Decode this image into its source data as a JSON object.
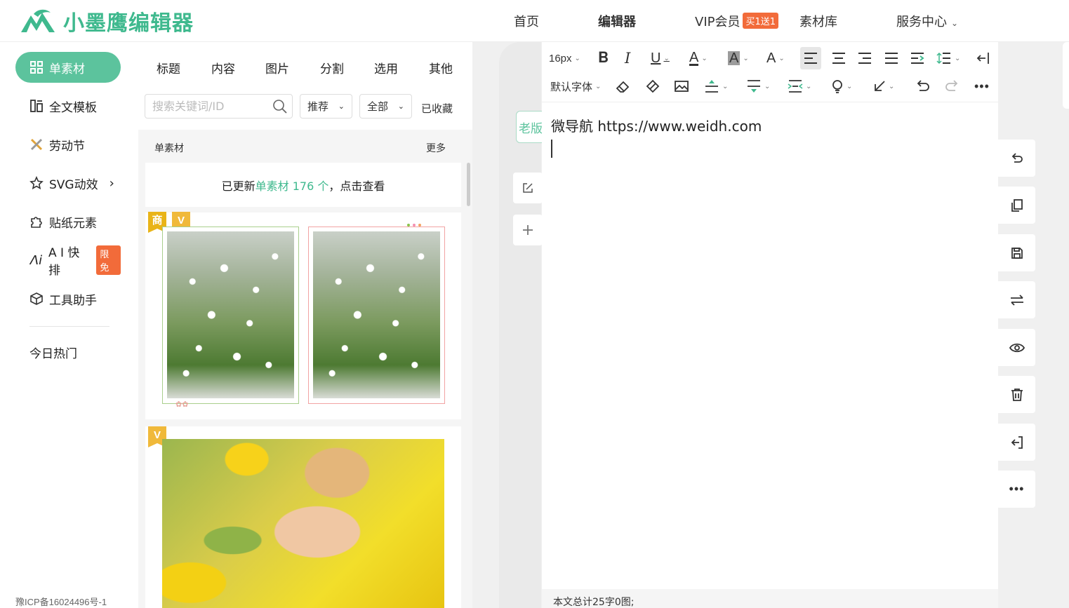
{
  "header": {
    "logo_text": "小墨鹰编辑器",
    "nav": {
      "home": "首页",
      "editor": "编辑器",
      "vip": "VIP会员",
      "vip_badge": "买1送1",
      "library": "素材库",
      "service": "服务中心"
    }
  },
  "sidebar": {
    "items": [
      {
        "label": "单素材"
      },
      {
        "label": "全文模板"
      },
      {
        "label": "劳动节"
      },
      {
        "label": "SVG动效"
      },
      {
        "label": "贴纸元素"
      },
      {
        "label": "A I 快排",
        "badge": "限免"
      },
      {
        "label": "工具助手"
      },
      {
        "label": "今日热门"
      }
    ],
    "icp": "豫ICP备16024496号-1"
  },
  "panel": {
    "tabs": [
      "标题",
      "内容",
      "图片",
      "分割",
      "选用",
      "其他"
    ],
    "search_placeholder": "搜索关键词/ID",
    "filter_sort": "推荐",
    "filter_scope": "全部",
    "favorites": "已收藏",
    "section_title": "单素材",
    "section_more": "更多",
    "notice_prefix": "已更新",
    "notice_highlight": "单素材 176 个",
    "notice_suffix": "，点击查看",
    "card_badges": {
      "shang": "商",
      "v": "V"
    }
  },
  "editor": {
    "old_version": "老版",
    "font_size": "16px",
    "font_family": "默认字体",
    "content_text": "微导航 https://www.weidh.com",
    "status_text": "本文总计25字0图;"
  },
  "colors": {
    "brand": "#5cc39d",
    "brand_text": "#3fb98e",
    "hot": "#f26b3a"
  }
}
